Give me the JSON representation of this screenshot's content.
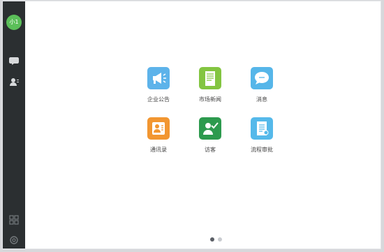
{
  "profile": {
    "avatar_text": "小1"
  },
  "sidebar": {
    "icons": [
      "chat-icon",
      "contacts-icon",
      "apps-grid-icon",
      "settings-icon"
    ]
  },
  "apps": [
    {
      "label": "企业公告",
      "icon": "megaphone-icon",
      "color": "#5db3ea"
    },
    {
      "label": "市场新闻",
      "icon": "newspaper-icon",
      "color": "#83c541"
    },
    {
      "label": "消息",
      "icon": "chat-bubble-icon",
      "color": "#56b6e9"
    },
    {
      "label": "通讯录",
      "icon": "address-book-icon",
      "color": "#f29631"
    },
    {
      "label": "访客",
      "icon": "visitor-icon",
      "color": "#2d9a4e"
    },
    {
      "label": "流程审批",
      "icon": "approval-document-icon",
      "color": "#55b9ea"
    }
  ],
  "pagination": {
    "current": 1,
    "total": 2
  },
  "colors": {
    "sidebar": "#2b2f31",
    "avatar": "#5bbf59",
    "page_dot_active": "#5b5f66",
    "page_dot_inactive": "#c9ccd0"
  }
}
